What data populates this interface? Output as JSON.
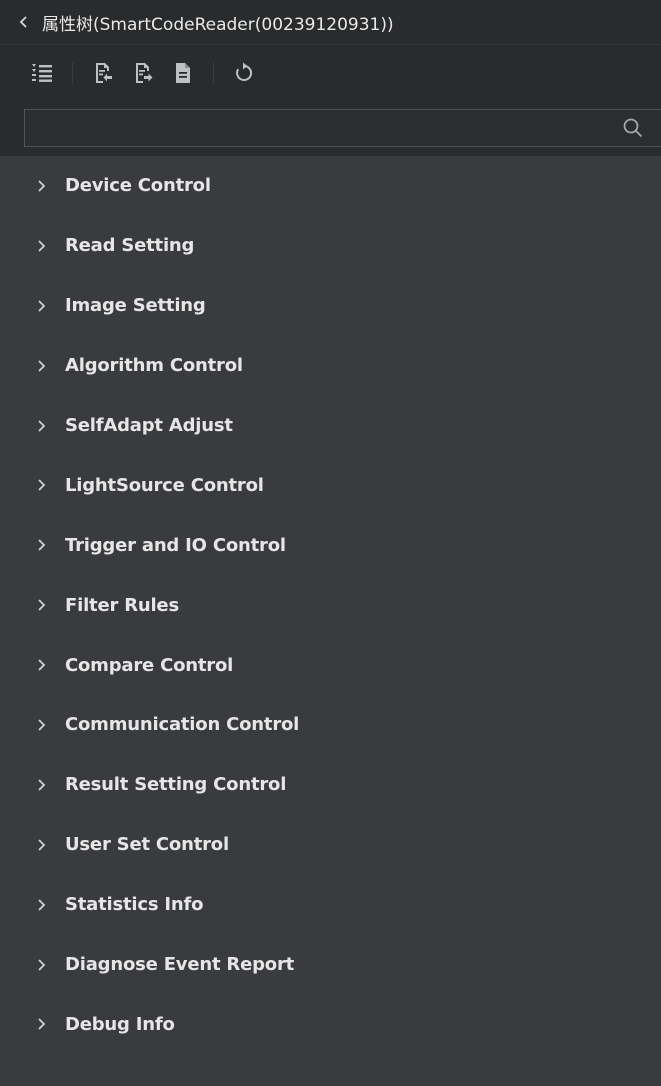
{
  "header": {
    "title": "属性树(SmartCodeReader(00239120931))"
  },
  "toolbar": {
    "buttons": [
      {
        "icon": "collapse-list-icon"
      },
      {
        "icon": "import-icon"
      },
      {
        "icon": "export-icon"
      },
      {
        "icon": "document-icon"
      },
      {
        "icon": "refresh-icon"
      }
    ]
  },
  "search": {
    "value": "",
    "placeholder": ""
  },
  "tree": {
    "items": [
      {
        "label": "Device Control"
      },
      {
        "label": "Read Setting"
      },
      {
        "label": "Image Setting"
      },
      {
        "label": "Algorithm Control"
      },
      {
        "label": "SelfAdapt Adjust"
      },
      {
        "label": "LightSource Control"
      },
      {
        "label": "Trigger and IO Control"
      },
      {
        "label": "Filter Rules"
      },
      {
        "label": "Compare Control"
      },
      {
        "label": "Communication Control"
      },
      {
        "label": "Result Setting Control"
      },
      {
        "label": "User Set Control"
      },
      {
        "label": "Statistics Info"
      },
      {
        "label": "Diagnose Event Report"
      },
      {
        "label": "Debug Info"
      }
    ]
  },
  "colors": {
    "background": "#3a3b3e",
    "header_bg": "#2a2b2d",
    "text": "#e6e6e6",
    "icon": "#bfc0c2"
  }
}
